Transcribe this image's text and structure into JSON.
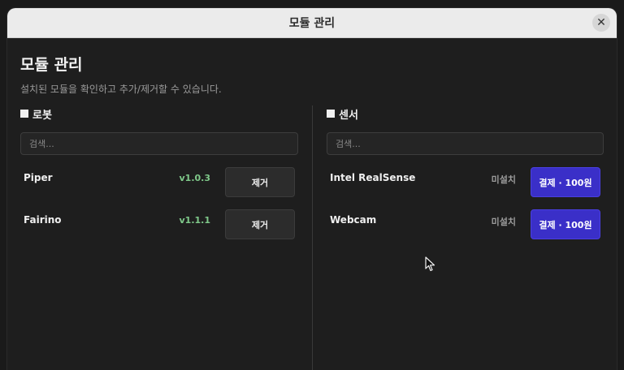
{
  "window": {
    "title": "모듈 관리",
    "close_glyph": "✕"
  },
  "page": {
    "title": "모듈 관리",
    "description": "설치된 모듈을 확인하고 추가/제거할 수 있습니다."
  },
  "robots": {
    "title": "로봇",
    "search_placeholder": "검색...",
    "items": [
      {
        "name": "Piper",
        "version": "v1.0.3",
        "action": "제거"
      },
      {
        "name": "Fairino",
        "version": "v1.1.1",
        "action": "제거"
      }
    ]
  },
  "sensors": {
    "title": "센서",
    "search_placeholder": "검색...",
    "items": [
      {
        "name": "Intel RealSense",
        "status": "미설치",
        "action": "결제 · 100원"
      },
      {
        "name": "Webcam",
        "status": "미설치",
        "action": "결제 · 100원"
      }
    ]
  },
  "colors": {
    "accent": "#3a2fc8",
    "version": "#7fc98a"
  }
}
